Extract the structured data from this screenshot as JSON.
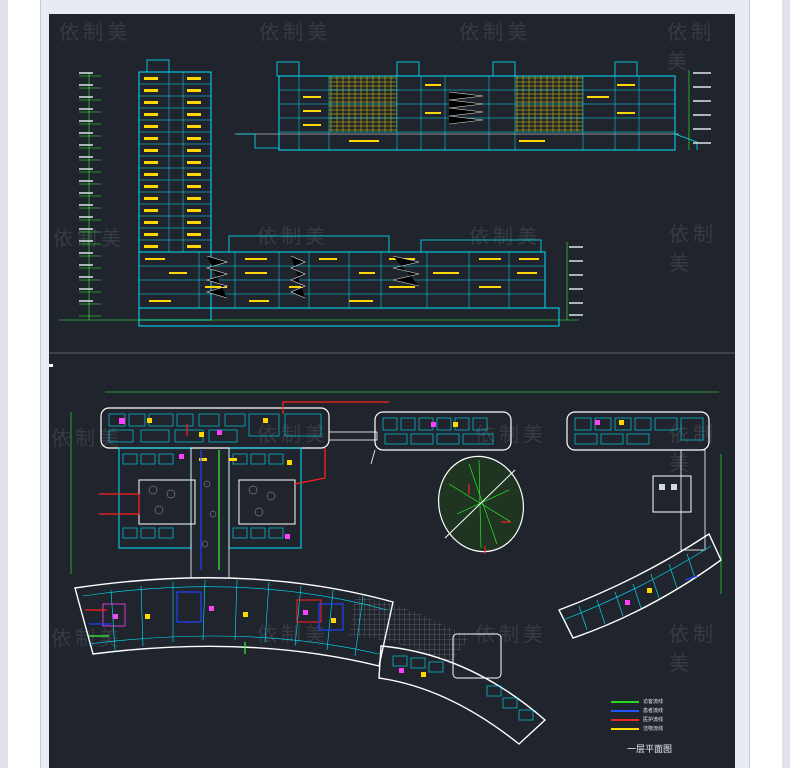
{
  "watermark": "依制美",
  "plan_title": "一层平面图",
  "legend": [
    {
      "label": "访客流线",
      "color": "#22dd22"
    },
    {
      "label": "患者流线",
      "color": "#2255ff"
    },
    {
      "label": "医护流线",
      "color": "#ee2222"
    },
    {
      "label": "洁物流线",
      "color": "#ffdd00"
    }
  ],
  "colors": {
    "wall": "#ffffff",
    "cyan": "#00e5ff",
    "yellow": "#ffd800",
    "green": "#2cff2c",
    "magenta": "#ff40ff",
    "red": "#ff2020",
    "blue": "#2040ff",
    "hatch": "#8a8a8a"
  }
}
